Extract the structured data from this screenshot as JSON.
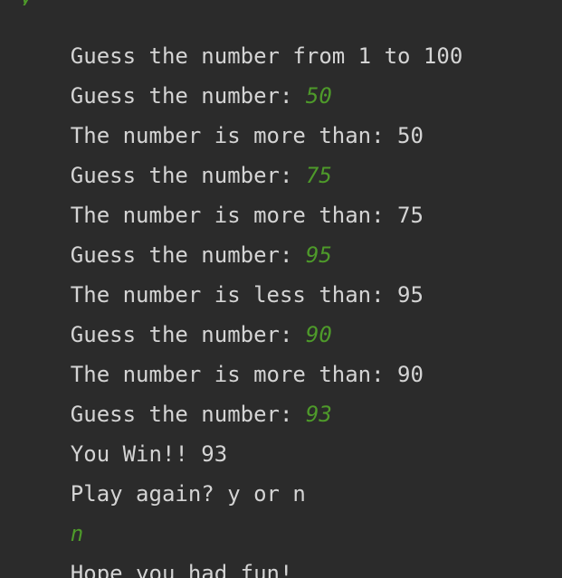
{
  "console": {
    "colors": {
      "background": "#2b2b2b",
      "output_text": "#d4d4d4",
      "user_input": "#4e9a2a"
    },
    "lines": [
      {
        "text": "Guess the number from 1 to 100"
      },
      {
        "text": "Guess the number: ",
        "input": "50"
      },
      {
        "text": "The number is more than: 50"
      },
      {
        "text": "Guess the number: ",
        "input": "75"
      },
      {
        "text": "The number is more than: 75"
      },
      {
        "text": "Guess the number: ",
        "input": "95"
      },
      {
        "text": "The number is less than: 95"
      },
      {
        "text": "Guess the number: ",
        "input": "90"
      },
      {
        "text": "The number is more than: 90"
      },
      {
        "text": "Guess the number: ",
        "input": "93"
      },
      {
        "text": "You Win!! 93"
      },
      {
        "text": "Play again? y or n"
      },
      {
        "text": "",
        "input": "n"
      },
      {
        "text": "Hope you had fun!"
      }
    ]
  }
}
